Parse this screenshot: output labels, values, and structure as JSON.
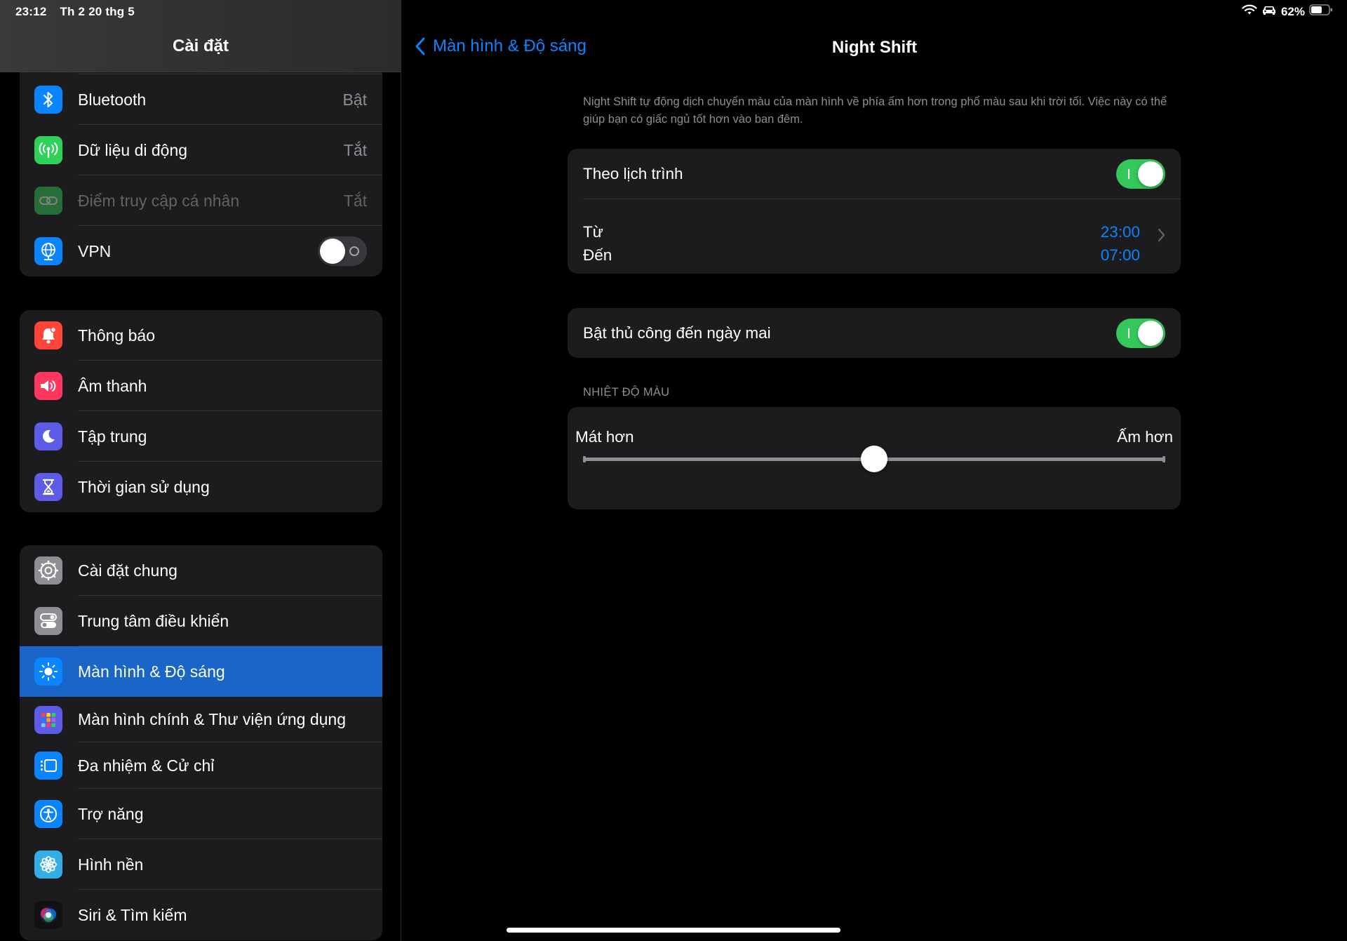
{
  "status": {
    "time": "23:12",
    "date": "Th 2 20 thg 5",
    "battery": "62%",
    "battery_level": 0.62
  },
  "sidebar": {
    "title": "Cài đặt",
    "group1": [
      {
        "label": "Bluetooth",
        "value": "Bật",
        "icon": "bluetooth-icon",
        "color": "#0a84ff"
      },
      {
        "label": "Dữ liệu di động",
        "value": "Tắt",
        "icon": "antenna-icon",
        "color": "#30d158"
      },
      {
        "label": "Điểm truy cập cá nhân",
        "value": "Tắt",
        "icon": "hotspot-link-icon",
        "color": "#30d158"
      },
      {
        "label": "VPN",
        "icon": "vpn-globe-icon",
        "color": "#0a84ff",
        "toggle": "off"
      }
    ],
    "group2": [
      {
        "label": "Thông báo",
        "icon": "bell-icon",
        "color": "#ff453a"
      },
      {
        "label": "Âm thanh",
        "icon": "speaker-icon",
        "color": "#ff375f"
      },
      {
        "label": "Tập trung",
        "icon": "moon-icon",
        "color": "#5e5ce6"
      },
      {
        "label": "Thời gian sử dụng",
        "icon": "hourglass-icon",
        "color": "#5e5ce6"
      }
    ],
    "group3": [
      {
        "label": "Cài đặt chung",
        "icon": "gear-icon",
        "color": "#8e8e93"
      },
      {
        "label": "Trung tâm điều khiển",
        "icon": "switches-icon",
        "color": "#8e8e93"
      },
      {
        "label": "Màn hình & Độ sáng",
        "icon": "sun-icon",
        "color": "#0a84ff",
        "selected": true
      },
      {
        "label": "Màn hình chính & Thư viện ứng dụng",
        "icon": "app-grid-icon",
        "color": "#5e5ce6"
      },
      {
        "label": "Đa nhiệm & Cử chỉ",
        "icon": "multitasking-icon",
        "color": "#0a84ff"
      },
      {
        "label": "Trợ năng",
        "icon": "accessibility-icon",
        "color": "#0a84ff"
      },
      {
        "label": "Hình nền",
        "icon": "flower-icon",
        "color": "#32ade6"
      },
      {
        "label": "Siri & Tìm kiếm",
        "icon": "siri-icon",
        "color": "#000000"
      }
    ]
  },
  "detail": {
    "back_label": "Màn hình & Độ sáng",
    "title": "Night Shift",
    "description": "Night Shift tự động dịch chuyển màu của màn hình về phía ấm hơn trong phổ màu sau khi trời tối. Việc này có thể giúp bạn có giấc ngủ tốt hơn vào ban đêm.",
    "schedule_label": "Theo lịch trình",
    "schedule_on": true,
    "from_label": "Từ",
    "to_label": "Đến",
    "from_time": "23:00",
    "to_time": "07:00",
    "manual_label": "Bật thủ công đến ngày mai",
    "manual_on": true,
    "temp_header": "NHIỆT ĐỘ MÀU",
    "cooler_label": "Mát hơn",
    "warmer_label": "Ấm hơn",
    "temperature_level": 0.5
  }
}
